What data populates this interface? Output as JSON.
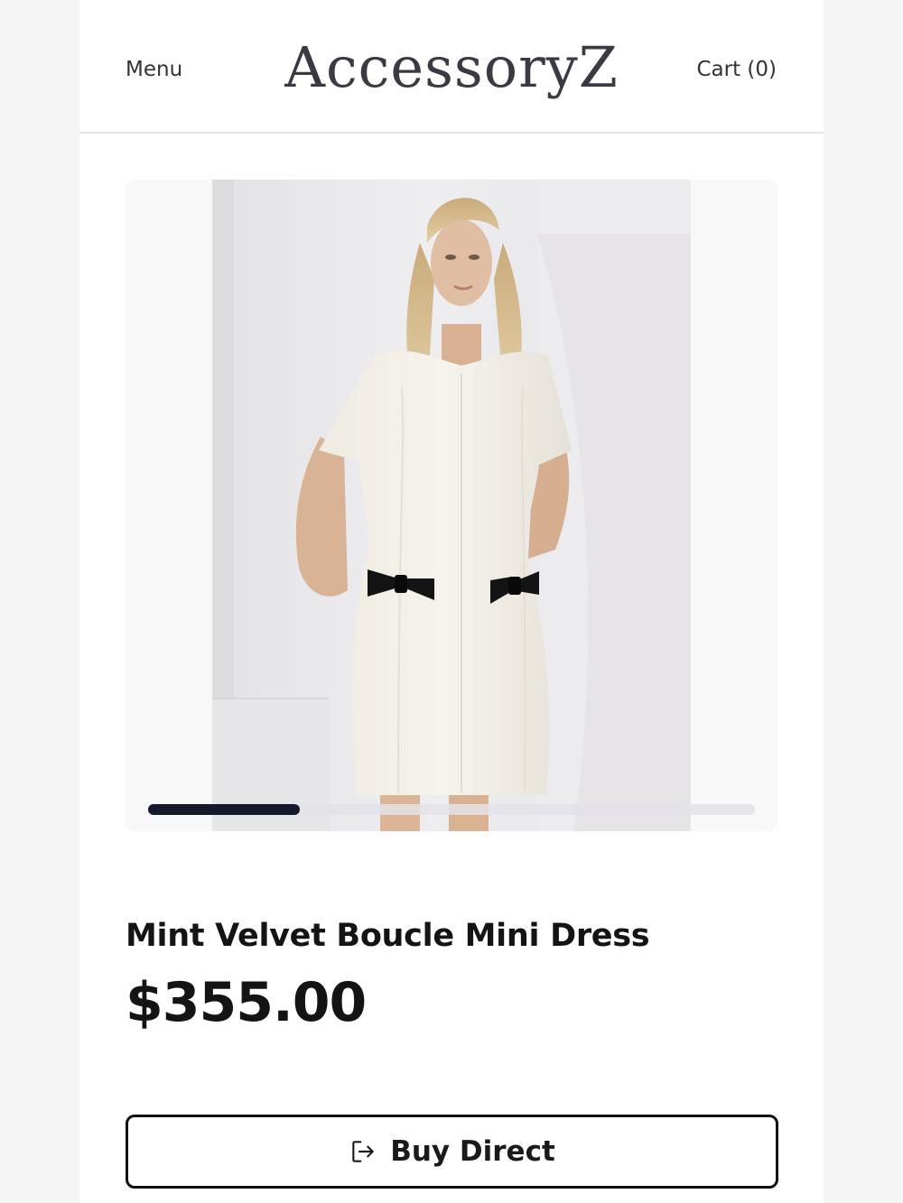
{
  "header": {
    "menu_label": "Menu",
    "brand": "AccessoryZ",
    "cart_label": "Cart (0)"
  },
  "gallery": {
    "image_alt": "Model wearing a white boucle mini dress with black bows",
    "progress_fraction": 0.25
  },
  "product": {
    "title": "Mint Velvet Boucle Mini Dress",
    "price": "$355.00",
    "buy_label": "Buy Direct",
    "buy_icon": "sign-out-icon"
  },
  "colors": {
    "page_bg": "#f5f5f5",
    "surface": "#ffffff",
    "brand_text": "#3a3a42",
    "progress_fill": "#141a2b",
    "progress_track": "#e2e2e8"
  }
}
